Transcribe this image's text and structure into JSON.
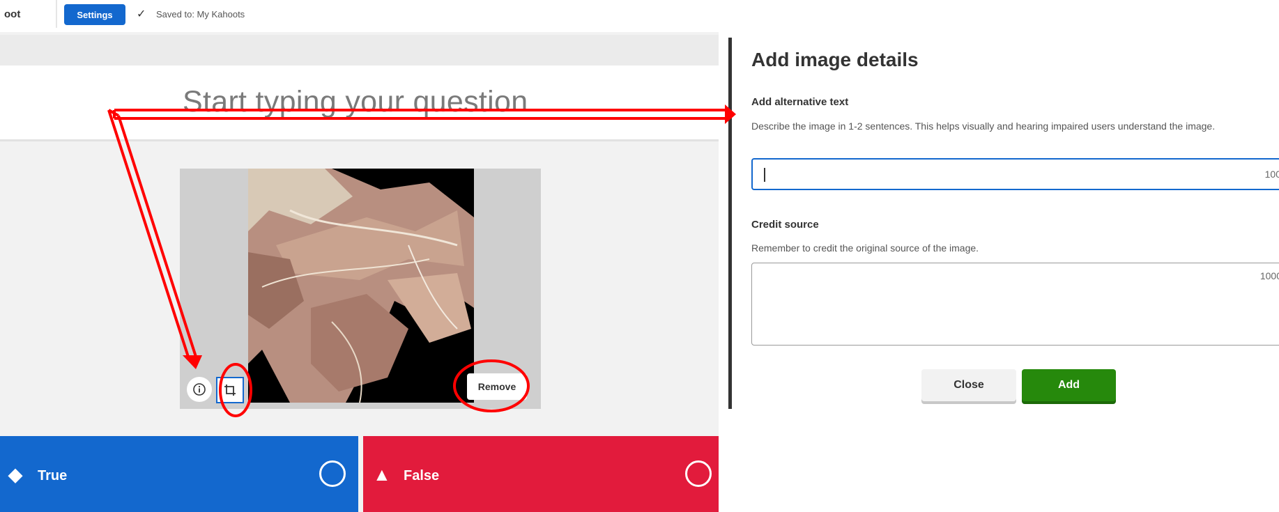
{
  "topbar": {
    "title_fragment": "oot",
    "settings_label": "Settings",
    "saved_icon": "checkmark-icon",
    "saved_text": "Saved to: My Kahoots"
  },
  "editor": {
    "question_placeholder": "Start typing your question",
    "image_actions": {
      "info_icon": "info-icon",
      "crop_icon": "crop-icon",
      "remove_label": "Remove"
    },
    "answers": [
      {
        "shape": "diamond-icon",
        "label": "True",
        "color": "#1368ce"
      },
      {
        "shape": "triangle-icon",
        "label": "False",
        "color": "#e21b3c"
      }
    ]
  },
  "panel": {
    "title": "Add image details",
    "alt_text": {
      "label": "Add alternative text",
      "help": "Describe the image in 1-2 sentences. This helps visually and hearing impaired users understand the image.",
      "value": "",
      "counter": "100"
    },
    "credit": {
      "label": "Credit source",
      "help": "Remember to credit the original source of the image.",
      "value": "",
      "counter": "1000"
    },
    "close_label": "Close",
    "add_label": "Add"
  },
  "colors": {
    "accent_blue": "#1368ce",
    "answer_red": "#e21b3c",
    "add_green": "#26890c",
    "annotation_red": "#ff0000"
  }
}
